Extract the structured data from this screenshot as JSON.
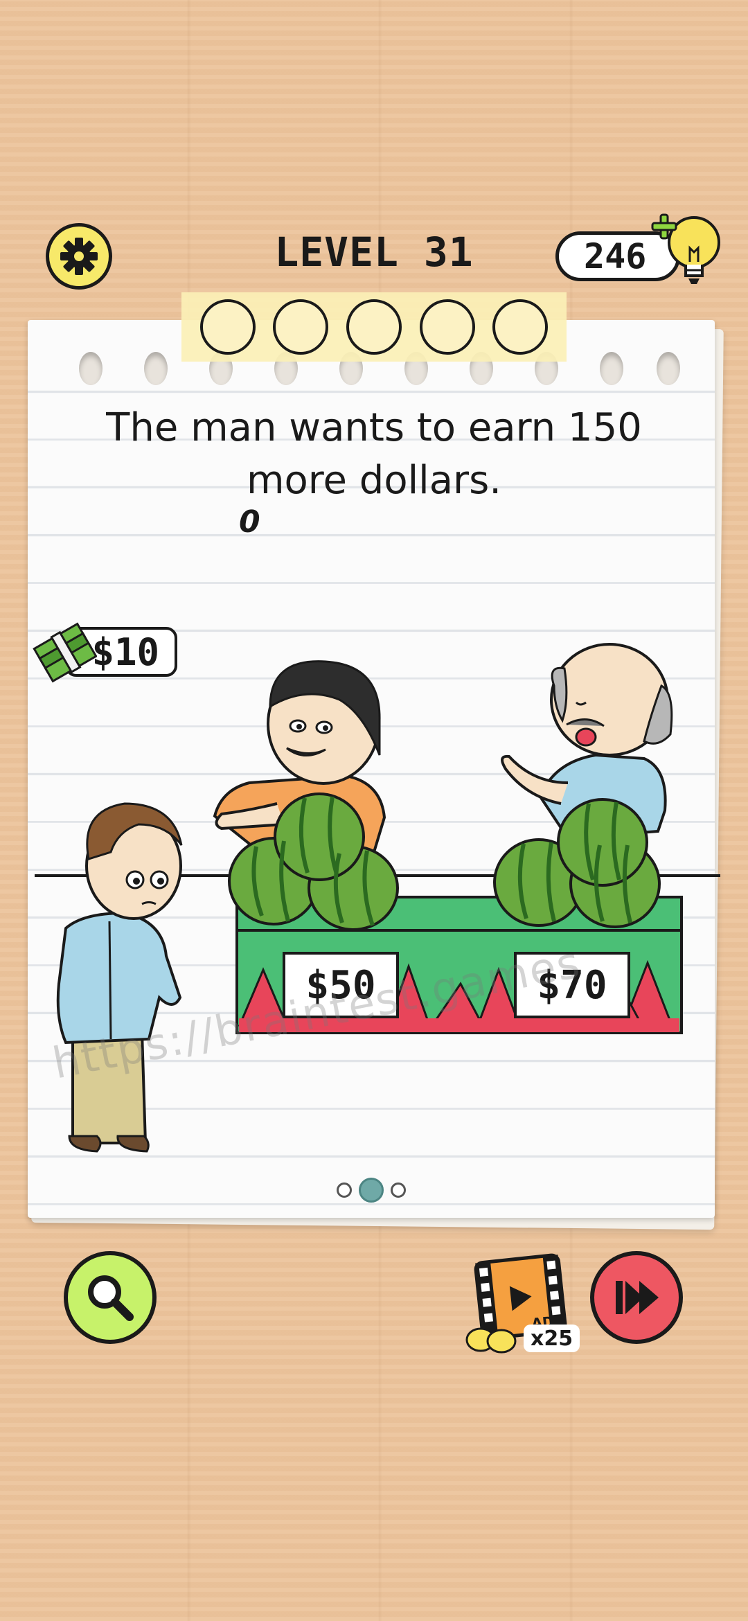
{
  "header": {
    "level_title": "LEVEL 31",
    "hint_count": "246",
    "settings_icon": "gear-icon",
    "hint_icon": "lightbulb-plus-icon"
  },
  "progress": {
    "total_steps": 5,
    "completed_steps": 0
  },
  "puzzle": {
    "question": "The man wants to earn 150 more dollars.",
    "counter_label": "0",
    "wallet_amount": "$10",
    "stall_left_price": "$50",
    "stall_right_price": "$70",
    "watermark": "https://braintest.games"
  },
  "pager": {
    "pages": 3,
    "active_index": 1
  },
  "footer": {
    "search_icon": "magnifier-icon",
    "ad_badge": "AD",
    "ad_hint_reward": "x25",
    "skip_icon": "fast-forward-icon"
  },
  "colors": {
    "background": "#ecc49c",
    "settings_button": "#f7e96a",
    "search_button": "#c7f26a",
    "skip_button": "#ee5762",
    "stall_green": "#4bbf76",
    "watermelon_red": "#e8455a",
    "active_dot": "#6fa9a7"
  }
}
